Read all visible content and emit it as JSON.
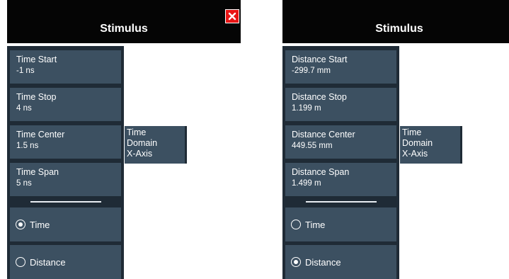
{
  "left_panel": {
    "title": "Stimulus",
    "close_label": "✕",
    "softkeys": [
      {
        "label": "Time Start",
        "value": "-1 ns"
      },
      {
        "label": "Time Stop",
        "value": "4 ns"
      },
      {
        "label": "Time Center",
        "value": "1.5 ns"
      },
      {
        "label": "Time Span",
        "value": "5 ns"
      }
    ],
    "radios": [
      {
        "label": "Time",
        "selected": true
      },
      {
        "label": "Distance",
        "selected": false
      }
    ],
    "side_tab": {
      "line1": "Time",
      "line2": "Domain",
      "line3": "X-Axis"
    }
  },
  "right_panel": {
    "title": "Stimulus",
    "close_label": "✕",
    "softkeys": [
      {
        "label": "Distance Start",
        "value": "-299.7 mm"
      },
      {
        "label": "Distance Stop",
        "value": "1.199 m"
      },
      {
        "label": "Distance Center",
        "value": "449.55 mm"
      },
      {
        "label": "Distance Span",
        "value": "1.499 m"
      }
    ],
    "radios": [
      {
        "label": "Time",
        "selected": false
      },
      {
        "label": "Distance",
        "selected": true
      }
    ],
    "side_tab": {
      "line1": "Time",
      "line2": "Domain",
      "line3": "X-Axis"
    }
  },
  "colors": {
    "header_bg": "#050505",
    "softkey_bg": "#3c5061",
    "panel_bg": "#1f2b36",
    "close_bg": "#e81515"
  }
}
